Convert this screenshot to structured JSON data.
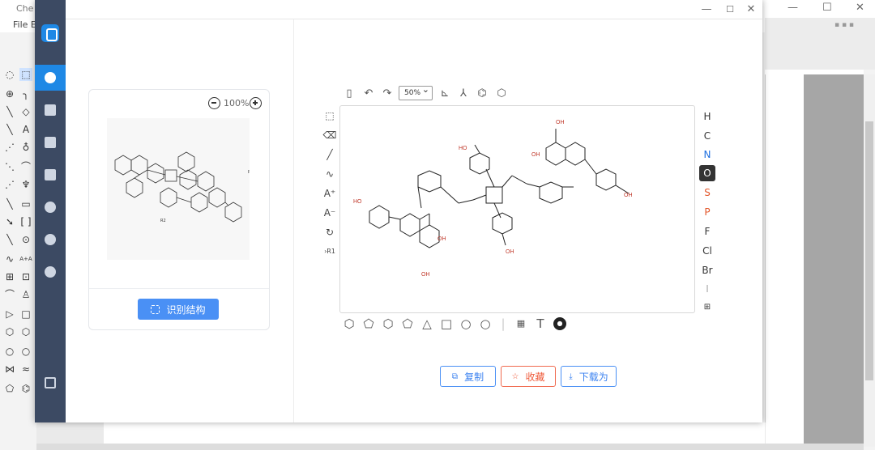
{
  "background_app": {
    "title": "Che",
    "menu_file": "File  E"
  },
  "sidebar": {
    "items": [
      {
        "icon": "molecule-icon",
        "active": true
      },
      {
        "icon": "layers-icon"
      },
      {
        "icon": "box-icon"
      },
      {
        "icon": "folder-icon"
      },
      {
        "icon": "gear-icon"
      },
      {
        "icon": "help-icon"
      },
      {
        "icon": "currency-icon"
      }
    ],
    "exit_icon": "logout-icon"
  },
  "card": {
    "zoom_level": "100%",
    "recognize_label": "识别结构"
  },
  "editor": {
    "zoom_value": "50%",
    "elements": [
      "H",
      "C",
      "N",
      "O",
      "S",
      "P",
      "F",
      "Cl",
      "Br",
      "I"
    ],
    "selected_element": "O",
    "left_tool_rgroup": "R1",
    "colors": {
      "N": "#1e6fe0",
      "O": "#ffffff",
      "S": "#e2572b",
      "P": "#e2572b",
      "default": "#333333"
    }
  },
  "molecule": {
    "labels": {
      "oh_top": "OH",
      "oh_left": "HO",
      "oh_right": "OH",
      "oh_bottom": "OH"
    }
  },
  "preview_labels": {
    "r2": "R2",
    "r": "R"
  },
  "actions": {
    "copy_label": "复制",
    "favorite_label": "收藏",
    "download_label": "下载为"
  }
}
